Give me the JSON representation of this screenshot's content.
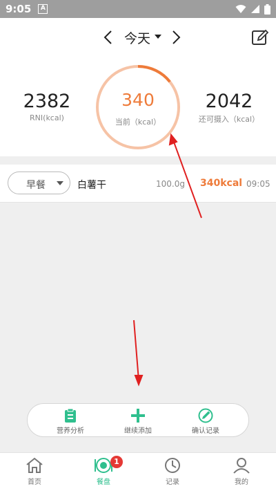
{
  "status_bar": {
    "time": "9:05",
    "notification_letter": "A"
  },
  "header": {
    "date_label": "今天"
  },
  "summary": {
    "rni_value": "2382",
    "rni_label": "RNI(kcal)",
    "current_value": "340",
    "current_label": "当前（kcal）",
    "remaining_value": "2042",
    "remaining_label": "还可摄入（kcal）",
    "ring_progress": 0.143
  },
  "food_entries": [
    {
      "meal": "早餐",
      "name": "白薯干",
      "weight": "100.0g",
      "kcal": "340kcal",
      "time": "09:05"
    }
  ],
  "action_bar": {
    "analysis_label": "营养分析",
    "add_label": "继续添加",
    "confirm_label": "确认记录"
  },
  "bottom_nav": {
    "home_label": "首页",
    "plate_label": "餐盘",
    "plate_badge": "1",
    "record_label": "记录",
    "mine_label": "我的"
  },
  "colors": {
    "accent_orange": "#ee7b3a",
    "ring_track": "#f6c3a6",
    "accent_green": "#2fbf8e",
    "badge_red": "#e53935"
  }
}
